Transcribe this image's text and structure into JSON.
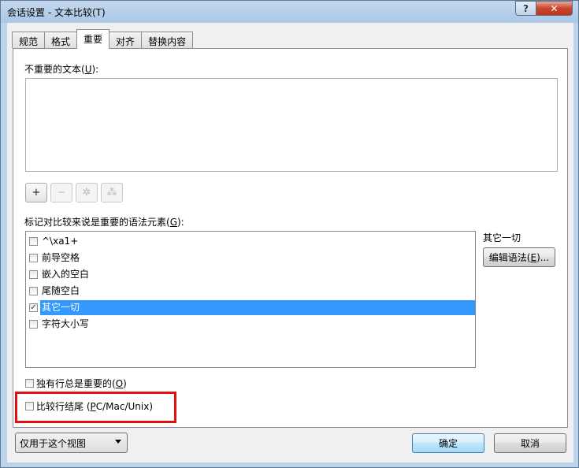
{
  "window": {
    "title": "会话设置 - 文本比较(T)",
    "help_label": "?",
    "close_label": "✕"
  },
  "tabs": [
    {
      "label": "规范",
      "active": false
    },
    {
      "label": "格式",
      "active": false
    },
    {
      "label": "重要",
      "active": true
    },
    {
      "label": "对齐",
      "active": false
    },
    {
      "label": "替换内容",
      "active": false
    }
  ],
  "unimportant_text": {
    "label": "不重要的文本(",
    "mnemonic": "U",
    "label_end": "):",
    "value": ""
  },
  "toolbar": [
    {
      "name": "add-button",
      "icon": "plus-icon",
      "glyph": "+",
      "disabled": false
    },
    {
      "name": "remove-button",
      "icon": "minus-icon",
      "glyph": "−",
      "disabled": true
    },
    {
      "name": "settings-button",
      "icon": "gear-icon",
      "glyph": "✲",
      "disabled": true
    },
    {
      "name": "group-button",
      "icon": "users-icon",
      "glyph": "⁂",
      "disabled": true
    }
  ],
  "syntax": {
    "label": "标记对比较来说是重要的语法元素(",
    "mnemonic": "G",
    "label_end": "):",
    "items": [
      {
        "label": "^\\xa1+",
        "checked": false,
        "selected": false
      },
      {
        "label": "前导空格",
        "checked": false,
        "selected": false
      },
      {
        "label": "嵌入的空白",
        "checked": false,
        "selected": false
      },
      {
        "label": "尾随空白",
        "checked": false,
        "selected": false
      },
      {
        "label": "其它一切",
        "checked": true,
        "selected": true
      },
      {
        "label": "字符大小写",
        "checked": false,
        "selected": false
      }
    ],
    "selected_name": "其它一切",
    "edit_label": "编辑语法(",
    "edit_mnemonic": "E",
    "edit_label_end": ")..."
  },
  "options": {
    "unique_lines": {
      "label": "独有行总是重要的(",
      "mnemonic": "O",
      "label_end": ")",
      "checked": false
    },
    "line_endings": {
      "label": "比较行结尾 (",
      "mnemonic": "P",
      "label_end": "C/Mac/Unix)",
      "checked": false
    }
  },
  "footer": {
    "scope_value": "仅用于这个视图",
    "ok_label": "确定",
    "cancel_label": "取消"
  },
  "colors": {
    "highlight": "#e01010",
    "selection": "#3399ff"
  }
}
